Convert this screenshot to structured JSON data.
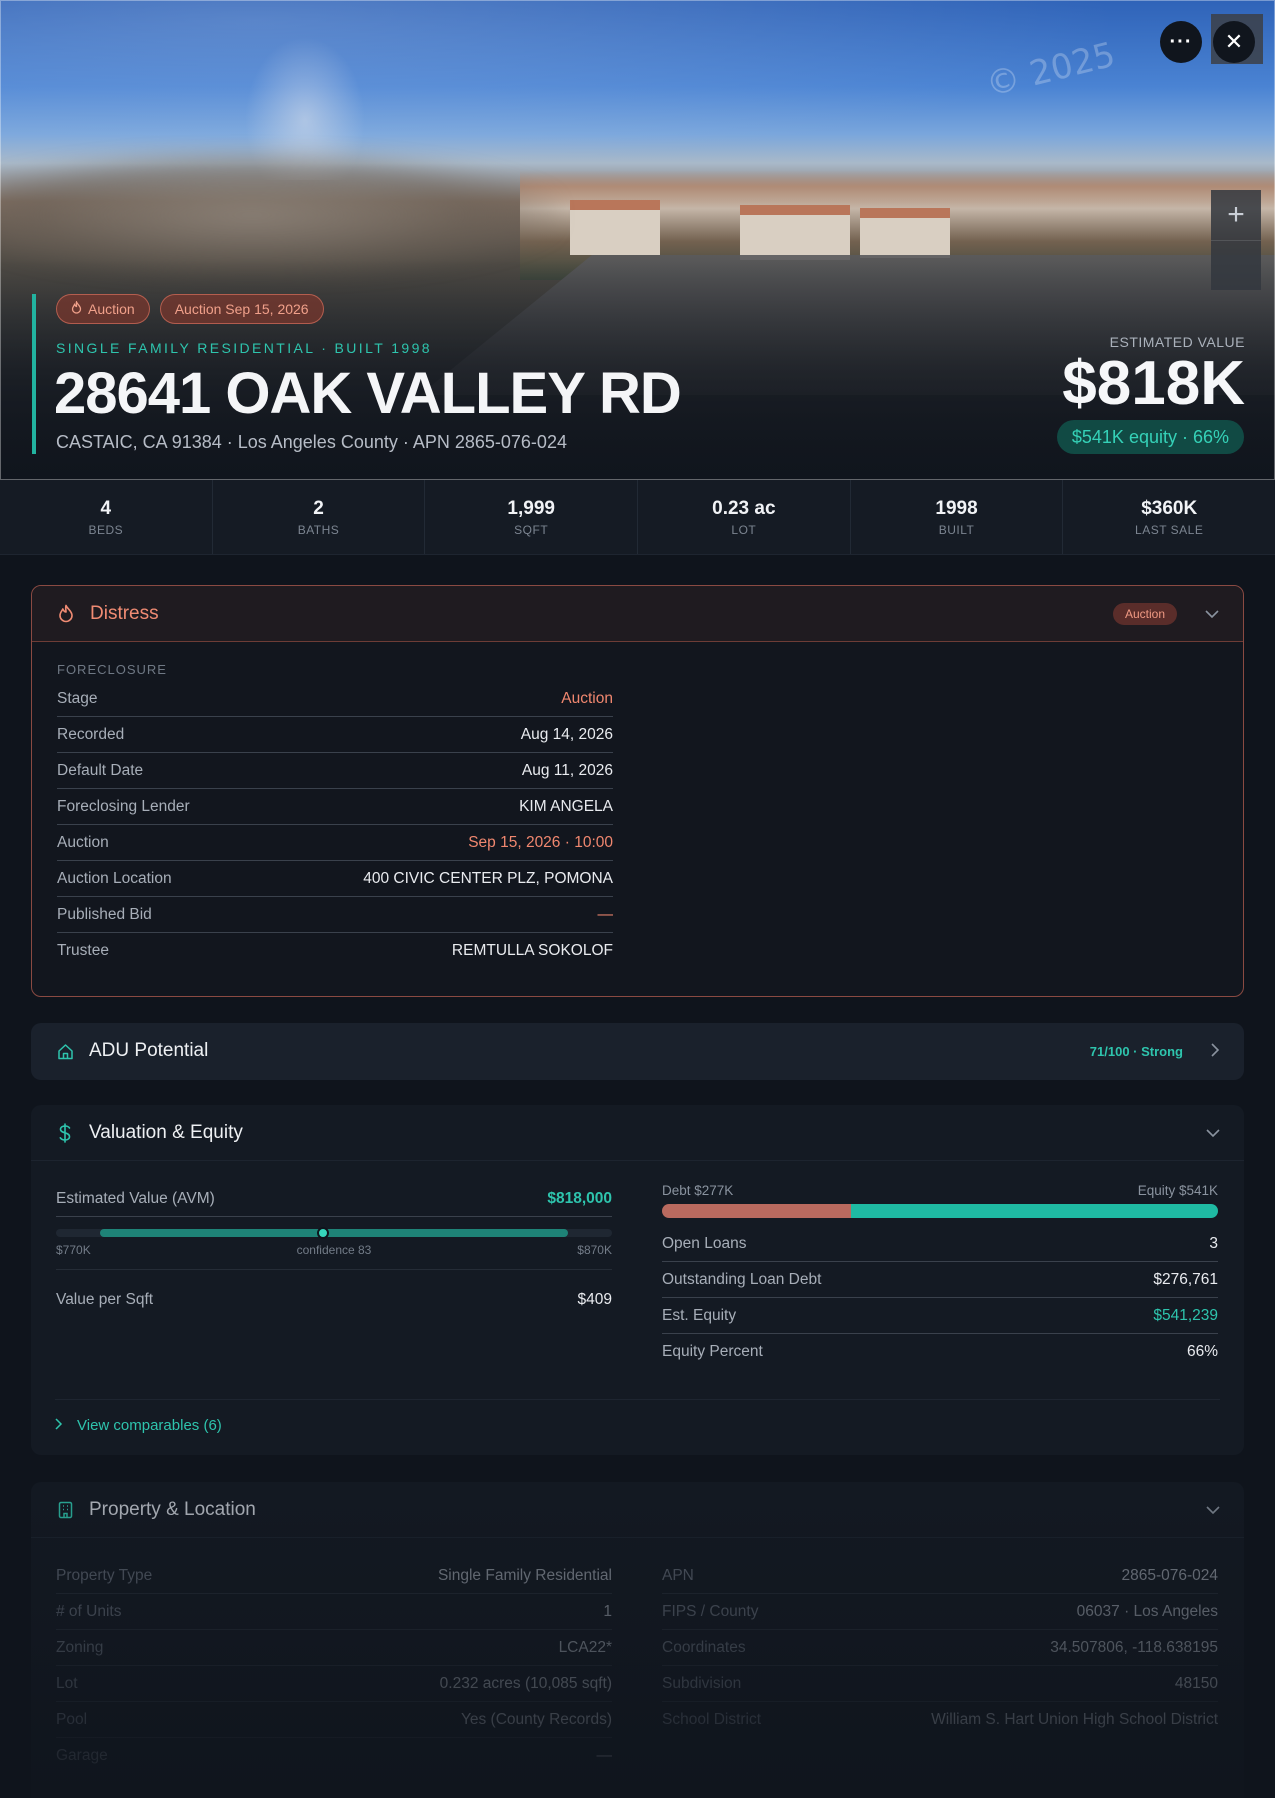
{
  "hero": {
    "watermark": "© 2025",
    "chips": [
      {
        "label": "Auction"
      },
      {
        "label": "Auction Sep 15, 2026"
      }
    ],
    "subtitle": "SINGLE FAMILY RESIDENTIAL · BUILT 1998",
    "address": "28641 OAK VALLEY RD",
    "meta": "CASTAIC, CA 91384 · Los Angeles County · APN 2865-076-024",
    "estimated_label": "ESTIMATED VALUE",
    "estimated_value": "$818K",
    "equity_pill": "$541K equity · 66%",
    "more_label": "···",
    "close_label": "✕",
    "zoom_in_label": "+"
  },
  "stats": [
    {
      "value": "4",
      "label": "BEDS"
    },
    {
      "value": "2",
      "label": "BATHS"
    },
    {
      "value": "1,999",
      "label": "SQFT"
    },
    {
      "value": "0.23 ac",
      "label": "LOT"
    },
    {
      "value": "1998",
      "label": "BUILT"
    },
    {
      "value": "$360K",
      "label": "LAST SALE"
    }
  ],
  "distress": {
    "title": "Distress",
    "badge": "Auction",
    "section": "FORECLOSURE",
    "rows": [
      {
        "k": "Stage",
        "v": "Auction"
      },
      {
        "k": "Recorded",
        "v": "Aug 14, 2026"
      },
      {
        "k": "Default Date",
        "v": "Aug 11, 2026"
      },
      {
        "k": "Foreclosing Lender",
        "v": "KIM ANGELA"
      },
      {
        "k": "Auction",
        "v": "Sep 15, 2026 · 10:00"
      },
      {
        "k": "Auction Location",
        "v": "400 CIVIC CENTER PLZ, POMONA"
      },
      {
        "k": "Published Bid",
        "v": "—"
      },
      {
        "k": "Trustee",
        "v": "REMTULLA SOKOLOF"
      }
    ]
  },
  "adu": {
    "title": "ADU Potential",
    "score": "71/100 · Strong"
  },
  "valuation": {
    "title": "Valuation & Equity",
    "avm_label": "Estimated Value (AVM)",
    "avm_value": "$818,000",
    "range_low": "$770K",
    "range_high": "$870K",
    "confidence": "confidence 83",
    "range_marker_fraction": 0.48,
    "vps_label": "Value per Sqft",
    "vps_value": "$409",
    "debt_label": "Debt $277K",
    "equity_label": "Equity $541K",
    "equity_fraction": 0.66,
    "rows": [
      {
        "k": "Open Loans",
        "v": "3"
      },
      {
        "k": "Outstanding Loan Debt",
        "v": "$276,761"
      },
      {
        "k": "Est. Equity",
        "v": "$541,239"
      },
      {
        "k": "Equity Percent",
        "v": "66%"
      }
    ],
    "comps_link": "View comparables (6)"
  },
  "property": {
    "title": "Property & Location",
    "left_rows": [
      {
        "k": "Property Type",
        "v": "Single Family Residential"
      },
      {
        "k": "# of Units",
        "v": "1"
      },
      {
        "k": "Zoning",
        "v": "LCA22*"
      },
      {
        "k": "Lot",
        "v": "0.232 acres (10,085 sqft)"
      },
      {
        "k": "Pool",
        "v": "Yes (County Records)"
      },
      {
        "k": "Garage",
        "v": "—"
      }
    ],
    "right_rows": [
      {
        "k": "APN",
        "v": "2865-076-024"
      },
      {
        "k": "FIPS / County",
        "v": "06037 · Los Angeles"
      },
      {
        "k": "Coordinates",
        "v": "34.507806, -118.638195"
      },
      {
        "k": "Subdivision",
        "v": "48150"
      },
      {
        "k": "School District",
        "v": "William S. Hart Union High School District"
      }
    ]
  },
  "colors": {
    "accent": "#2ec4ad",
    "distress": "#f08b73",
    "background": "#0f141c",
    "debt": "#b96a5f",
    "equity": "#1fbaa3"
  },
  "icons": {
    "more": "more-horizontal-icon",
    "close": "close-icon",
    "zoom_in": "plus-icon",
    "distress": "flame-icon",
    "adu": "house-icon",
    "valuation": "dollar-icon",
    "property": "building-icon"
  }
}
